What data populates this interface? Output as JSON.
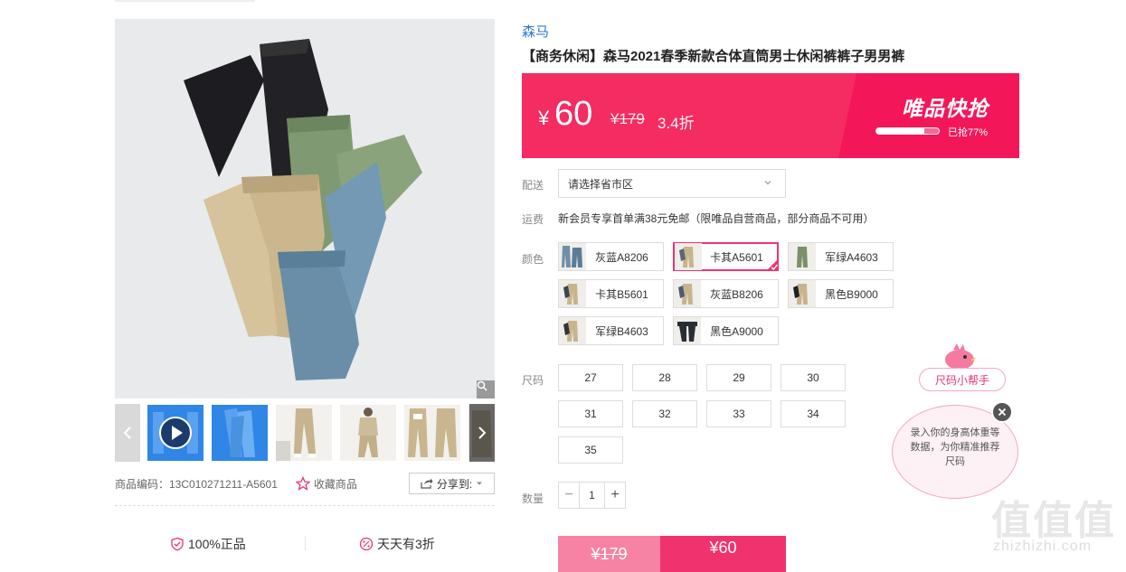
{
  "brand": "森马",
  "title": "【商务休闲】森马2021春季新款合体直筒男士休闲裤裤子男男裤",
  "price": {
    "currency": "¥",
    "value": "60",
    "original": "¥179",
    "discount": "3.4折",
    "flash_title": "唯品快抢",
    "sold_percent": 77,
    "sold_text": "已抢77%"
  },
  "delivery": {
    "label": "配送",
    "placeholder": "请选择省市区"
  },
  "shipping": {
    "label": "运费",
    "text": "新会员专享首单满38元免邮（限唯品自营商品，部分商品不可用）"
  },
  "colors": {
    "label": "颜色",
    "options": [
      "灰蓝A8206",
      "卡其A5601",
      "军绿A4603",
      "卡其B5601",
      "灰蓝B8206",
      "黑色B9000",
      "军绿B4603",
      "黑色A9000"
    ],
    "selected": "卡其A5601"
  },
  "sizes": {
    "label": "尺码",
    "options": [
      "27",
      "28",
      "29",
      "30",
      "31",
      "32",
      "33",
      "34",
      "35"
    ]
  },
  "quantity": {
    "label": "数量",
    "value": "1",
    "minus": "−",
    "plus": "+"
  },
  "buy": {
    "original": "¥179",
    "price": "¥60"
  },
  "product_code": "商品编码：13C010271211-A5601",
  "favorite": "收藏商品",
  "share": "分享到:",
  "guarantees": [
    "100%正品",
    "天天有3折"
  ],
  "size_helper": {
    "tag": "尺码小帮手",
    "text": "录入你的身高体重等数据，为你精准推荐尺码"
  },
  "watermark": {
    "main": "值值值",
    "sub": "zhizhizhi.com"
  },
  "colors_palette": {
    "accent": "#f0336e",
    "banner": "#f42c61",
    "brand_link": "#2a78d0"
  }
}
